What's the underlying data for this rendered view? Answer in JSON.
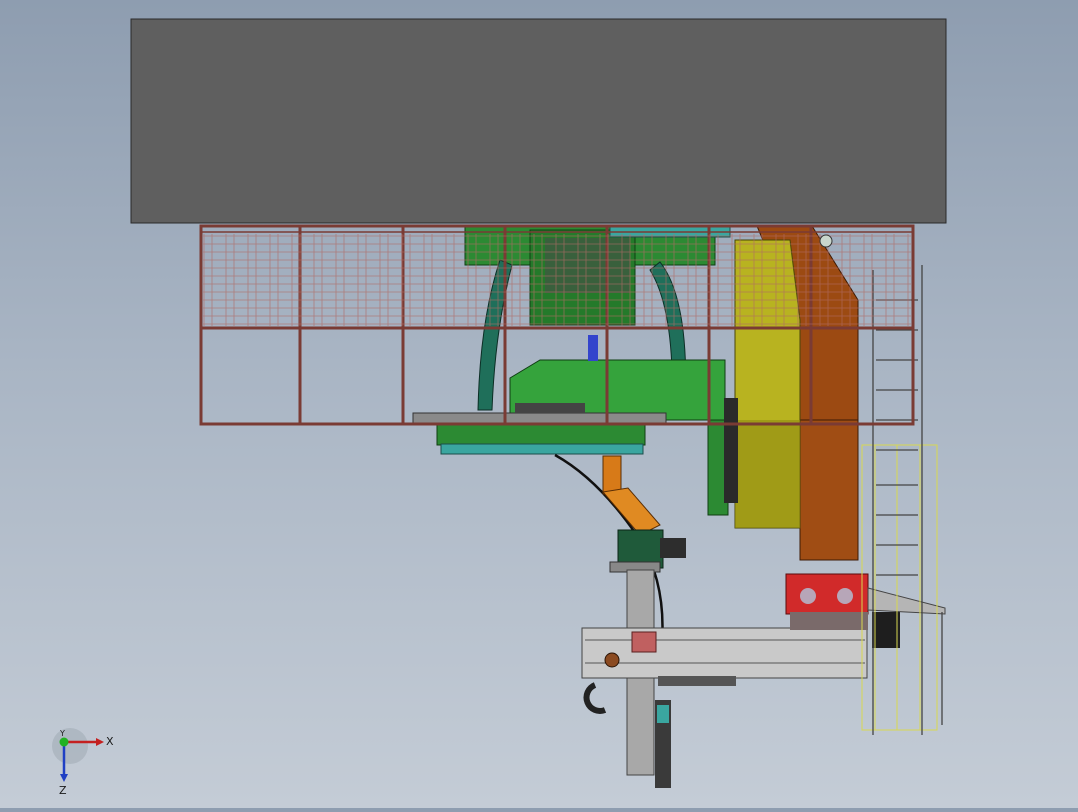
{
  "viewport": {
    "background_top": "#8e9db0",
    "background_bottom": "#c4ccd6"
  },
  "model_colors": {
    "roof": "#5f5f5f",
    "frame": "#7a3b34",
    "machine_green": "#2c8a33",
    "column_brown": "#9c4a12",
    "panel_yellow": "#b8b320",
    "teal_plate": "#3aa6a0",
    "robot_orange": "#d77a18",
    "base_red": "#d12a2a",
    "ladder_yellow": "#d8d850",
    "rail_gray": "#a8a8a8"
  },
  "triad": {
    "x_label": "X",
    "y_label": "Y",
    "z_label": "Z"
  }
}
